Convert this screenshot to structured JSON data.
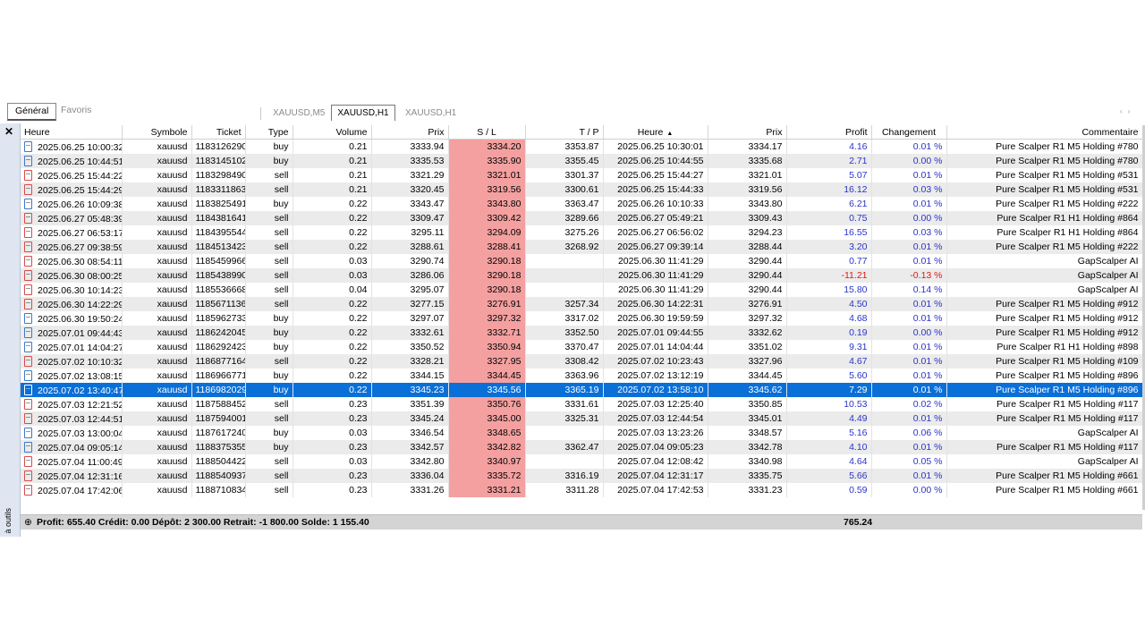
{
  "tabs": {
    "general": "Général",
    "favoris": "Favoris"
  },
  "chart_tabs": [
    "XAUUSD,M5",
    "XAUUSD,H1",
    "XAUUSD,H1"
  ],
  "side_label": "à outils",
  "columns": [
    "Heure",
    "Symbole",
    "Ticket",
    "Type",
    "Volume",
    "Prix",
    "S / L",
    "T / P",
    "Heure",
    "Prix",
    "Profit",
    "Changement",
    "Commentaire"
  ],
  "rows": [
    {
      "open_time": "2025.06.25 10:00:32",
      "symbol": "xauusd",
      "ticket": "1183126290",
      "type": "buy",
      "volume": "0.21",
      "open_price": "3333.94",
      "sl": "3334.20",
      "tp": "3353.87",
      "close_time": "2025.06.25 10:30:01",
      "close_price": "3334.17",
      "profit": "4.16",
      "change": "0.01 %",
      "comment": "Pure Scalper R1 M5 Holding #780"
    },
    {
      "open_time": "2025.06.25 10:44:51",
      "symbol": "xauusd",
      "ticket": "1183145102",
      "type": "buy",
      "volume": "0.21",
      "open_price": "3335.53",
      "sl": "3335.90",
      "tp": "3355.45",
      "close_time": "2025.06.25 10:44:55",
      "close_price": "3335.68",
      "profit": "2.71",
      "change": "0.00 %",
      "comment": "Pure Scalper R1 M5 Holding #780"
    },
    {
      "open_time": "2025.06.25 15:44:22",
      "symbol": "xauusd",
      "ticket": "1183298490",
      "type": "sell",
      "volume": "0.21",
      "open_price": "3321.29",
      "sl": "3321.01",
      "tp": "3301.37",
      "close_time": "2025.06.25 15:44:27",
      "close_price": "3321.01",
      "profit": "5.07",
      "change": "0.01 %",
      "comment": "Pure Scalper R1 M5 Holding #531"
    },
    {
      "open_time": "2025.06.25 15:44:29",
      "symbol": "xauusd",
      "ticket": "1183311863",
      "type": "sell",
      "volume": "0.21",
      "open_price": "3320.45",
      "sl": "3319.56",
      "tp": "3300.61",
      "close_time": "2025.06.25 15:44:33",
      "close_price": "3319.56",
      "profit": "16.12",
      "change": "0.03 %",
      "comment": "Pure Scalper R1 M5 Holding #531"
    },
    {
      "open_time": "2025.06.26 10:09:38",
      "symbol": "xauusd",
      "ticket": "1183825491",
      "type": "buy",
      "volume": "0.22",
      "open_price": "3343.47",
      "sl": "3343.80",
      "tp": "3363.47",
      "close_time": "2025.06.26 10:10:33",
      "close_price": "3343.80",
      "profit": "6.21",
      "change": "0.01 %",
      "comment": "Pure Scalper R1 M5 Holding #222"
    },
    {
      "open_time": "2025.06.27 05:48:39",
      "symbol": "xauusd",
      "ticket": "1184381641",
      "type": "sell",
      "volume": "0.22",
      "open_price": "3309.47",
      "sl": "3309.42",
      "tp": "3289.66",
      "close_time": "2025.06.27 05:49:21",
      "close_price": "3309.43",
      "profit": "0.75",
      "change": "0.00 %",
      "comment": "Pure Scalper R1 H1 Holding #864"
    },
    {
      "open_time": "2025.06.27 06:53:17",
      "symbol": "xauusd",
      "ticket": "1184395544",
      "type": "sell",
      "volume": "0.22",
      "open_price": "3295.11",
      "sl": "3294.09",
      "tp": "3275.26",
      "close_time": "2025.06.27 06:56:02",
      "close_price": "3294.23",
      "profit": "16.55",
      "change": "0.03 %",
      "comment": "Pure Scalper R1 H1 Holding #864"
    },
    {
      "open_time": "2025.06.27 09:38:59",
      "symbol": "xauusd",
      "ticket": "1184513423",
      "type": "sell",
      "volume": "0.22",
      "open_price": "3288.61",
      "sl": "3288.41",
      "tp": "3268.92",
      "close_time": "2025.06.27 09:39:14",
      "close_price": "3288.44",
      "profit": "3.20",
      "change": "0.01 %",
      "comment": "Pure Scalper R1 M5 Holding #222"
    },
    {
      "open_time": "2025.06.30 08:54:11",
      "symbol": "xauusd",
      "ticket": "1185459966",
      "type": "sell",
      "volume": "0.03",
      "open_price": "3290.74",
      "sl": "3290.18",
      "tp": "",
      "close_time": "2025.06.30 11:41:29",
      "close_price": "3290.44",
      "profit": "0.77",
      "change": "0.01 %",
      "comment": "GapScalper AI"
    },
    {
      "open_time": "2025.06.30 08:00:25",
      "symbol": "xauusd",
      "ticket": "1185438990",
      "type": "sell",
      "volume": "0.03",
      "open_price": "3286.06",
      "sl": "3290.18",
      "tp": "",
      "close_time": "2025.06.30 11:41:29",
      "close_price": "3290.44",
      "profit": "-11.21",
      "change": "-0.13 %",
      "comment": "GapScalper AI"
    },
    {
      "open_time": "2025.06.30 10:14:23",
      "symbol": "xauusd",
      "ticket": "1185536668",
      "type": "sell",
      "volume": "0.04",
      "open_price": "3295.07",
      "sl": "3290.18",
      "tp": "",
      "close_time": "2025.06.30 11:41:29",
      "close_price": "3290.44",
      "profit": "15.80",
      "change": "0.14 %",
      "comment": "GapScalper AI"
    },
    {
      "open_time": "2025.06.30 14:22:29",
      "symbol": "xauusd",
      "ticket": "1185671136",
      "type": "sell",
      "volume": "0.22",
      "open_price": "3277.15",
      "sl": "3276.91",
      "tp": "3257.34",
      "close_time": "2025.06.30 14:22:31",
      "close_price": "3276.91",
      "profit": "4.50",
      "change": "0.01 %",
      "comment": "Pure Scalper R1 M5 Holding #912"
    },
    {
      "open_time": "2025.06.30 19:50:24",
      "symbol": "xauusd",
      "ticket": "1185962733",
      "type": "buy",
      "volume": "0.22",
      "open_price": "3297.07",
      "sl": "3297.32",
      "tp": "3317.02",
      "close_time": "2025.06.30 19:59:59",
      "close_price": "3297.32",
      "profit": "4.68",
      "change": "0.01 %",
      "comment": "Pure Scalper R1 M5 Holding #912"
    },
    {
      "open_time": "2025.07.01 09:44:43",
      "symbol": "xauusd",
      "ticket": "1186242045",
      "type": "buy",
      "volume": "0.22",
      "open_price": "3332.61",
      "sl": "3332.71",
      "tp": "3352.50",
      "close_time": "2025.07.01 09:44:55",
      "close_price": "3332.62",
      "profit": "0.19",
      "change": "0.00 %",
      "comment": "Pure Scalper R1 M5 Holding #912"
    },
    {
      "open_time": "2025.07.01 14:04:27",
      "symbol": "xauusd",
      "ticket": "1186292423",
      "type": "buy",
      "volume": "0.22",
      "open_price": "3350.52",
      "sl": "3350.94",
      "tp": "3370.47",
      "close_time": "2025.07.01 14:04:44",
      "close_price": "3351.02",
      "profit": "9.31",
      "change": "0.01 %",
      "comment": "Pure Scalper R1 H1 Holding #898"
    },
    {
      "open_time": "2025.07.02 10:10:32",
      "symbol": "xauusd",
      "ticket": "1186877164",
      "type": "sell",
      "volume": "0.22",
      "open_price": "3328.21",
      "sl": "3327.95",
      "tp": "3308.42",
      "close_time": "2025.07.02 10:23:43",
      "close_price": "3327.96",
      "profit": "4.67",
      "change": "0.01 %",
      "comment": "Pure Scalper R1 M5 Holding #109"
    },
    {
      "open_time": "2025.07.02 13:08:15",
      "symbol": "xauusd",
      "ticket": "1186966771",
      "type": "buy",
      "volume": "0.22",
      "open_price": "3344.15",
      "sl": "3344.45",
      "tp": "3363.96",
      "close_time": "2025.07.02 13:12:19",
      "close_price": "3344.45",
      "profit": "5.60",
      "change": "0.01 %",
      "comment": "Pure Scalper R1 M5 Holding #896"
    },
    {
      "open_time": "2025.07.02 13:40:47",
      "symbol": "xauusd",
      "ticket": "1186982029",
      "type": "buy",
      "volume": "0.22",
      "open_price": "3345.23",
      "sl": "3345.56",
      "tp": "3365.19",
      "close_time": "2025.07.02 13:58:10",
      "close_price": "3345.62",
      "profit": "7.29",
      "change": "0.01 %",
      "comment": "Pure Scalper R1 M5 Holding #896",
      "selected": true
    },
    {
      "open_time": "2025.07.03 12:21:52",
      "symbol": "xauusd",
      "ticket": "1187588452",
      "type": "sell",
      "volume": "0.23",
      "open_price": "3351.39",
      "sl": "3350.76",
      "tp": "3331.61",
      "close_time": "2025.07.03 12:25:40",
      "close_price": "3350.85",
      "profit": "10.53",
      "change": "0.02 %",
      "comment": "Pure Scalper R1 M5 Holding #117"
    },
    {
      "open_time": "2025.07.03 12:44:51",
      "symbol": "xauusd",
      "ticket": "1187594001",
      "type": "sell",
      "volume": "0.23",
      "open_price": "3345.24",
      "sl": "3345.00",
      "tp": "3325.31",
      "close_time": "2025.07.03 12:44:54",
      "close_price": "3345.01",
      "profit": "4.49",
      "change": "0.01 %",
      "comment": "Pure Scalper R1 M5 Holding #117"
    },
    {
      "open_time": "2025.07.03 13:00:04",
      "symbol": "xauusd",
      "ticket": "1187617240",
      "type": "buy",
      "volume": "0.03",
      "open_price": "3346.54",
      "sl": "3348.65",
      "tp": "",
      "close_time": "2025.07.03 13:23:26",
      "close_price": "3348.57",
      "profit": "5.16",
      "change": "0.06 %",
      "comment": "GapScalper AI"
    },
    {
      "open_time": "2025.07.04 09:05:14",
      "symbol": "xauusd",
      "ticket": "1188375355",
      "type": "buy",
      "volume": "0.23",
      "open_price": "3342.57",
      "sl": "3342.82",
      "tp": "3362.47",
      "close_time": "2025.07.04 09:05:23",
      "close_price": "3342.78",
      "profit": "4.10",
      "change": "0.01 %",
      "comment": "Pure Scalper R1 M5 Holding #117"
    },
    {
      "open_time": "2025.07.04 11:00:49",
      "symbol": "xauusd",
      "ticket": "1188504422",
      "type": "sell",
      "volume": "0.03",
      "open_price": "3342.80",
      "sl": "3340.97",
      "tp": "",
      "close_time": "2025.07.04 12:08:42",
      "close_price": "3340.98",
      "profit": "4.64",
      "change": "0.05 %",
      "comment": "GapScalper AI"
    },
    {
      "open_time": "2025.07.04 12:31:16",
      "symbol": "xauusd",
      "ticket": "1188540937",
      "type": "sell",
      "volume": "0.23",
      "open_price": "3336.04",
      "sl": "3335.72",
      "tp": "3316.19",
      "close_time": "2025.07.04 12:31:17",
      "close_price": "3335.75",
      "profit": "5.66",
      "change": "0.01 %",
      "comment": "Pure Scalper R1 M5 Holding #661"
    },
    {
      "open_time": "2025.07.04 17:42:06",
      "symbol": "xauusd",
      "ticket": "1188710834",
      "type": "sell",
      "volume": "0.23",
      "open_price": "3331.26",
      "sl": "3331.21",
      "tp": "3311.28",
      "close_time": "2025.07.04 17:42:53",
      "close_price": "3331.23",
      "profit": "0.59",
      "change": "0.00 %",
      "comment": "Pure Scalper R1 M5 Holding #661"
    }
  ],
  "summary": {
    "text": "Profit: 655.40  Crédit: 0.00  Dépôt: 2 300.00  Retrait: -1 800.00  Solde: 1 155.40",
    "total": "765.24"
  },
  "colors": {
    "selection": "#0a6fd6",
    "sl_highlight": "#f4a0a0",
    "positive": "#2a34c8",
    "negative": "#e01818"
  },
  "icons": {
    "close": "close-icon",
    "expand": "plus-circle-icon",
    "sort": "sort-up-icon",
    "trade": "trade-document-icon"
  }
}
